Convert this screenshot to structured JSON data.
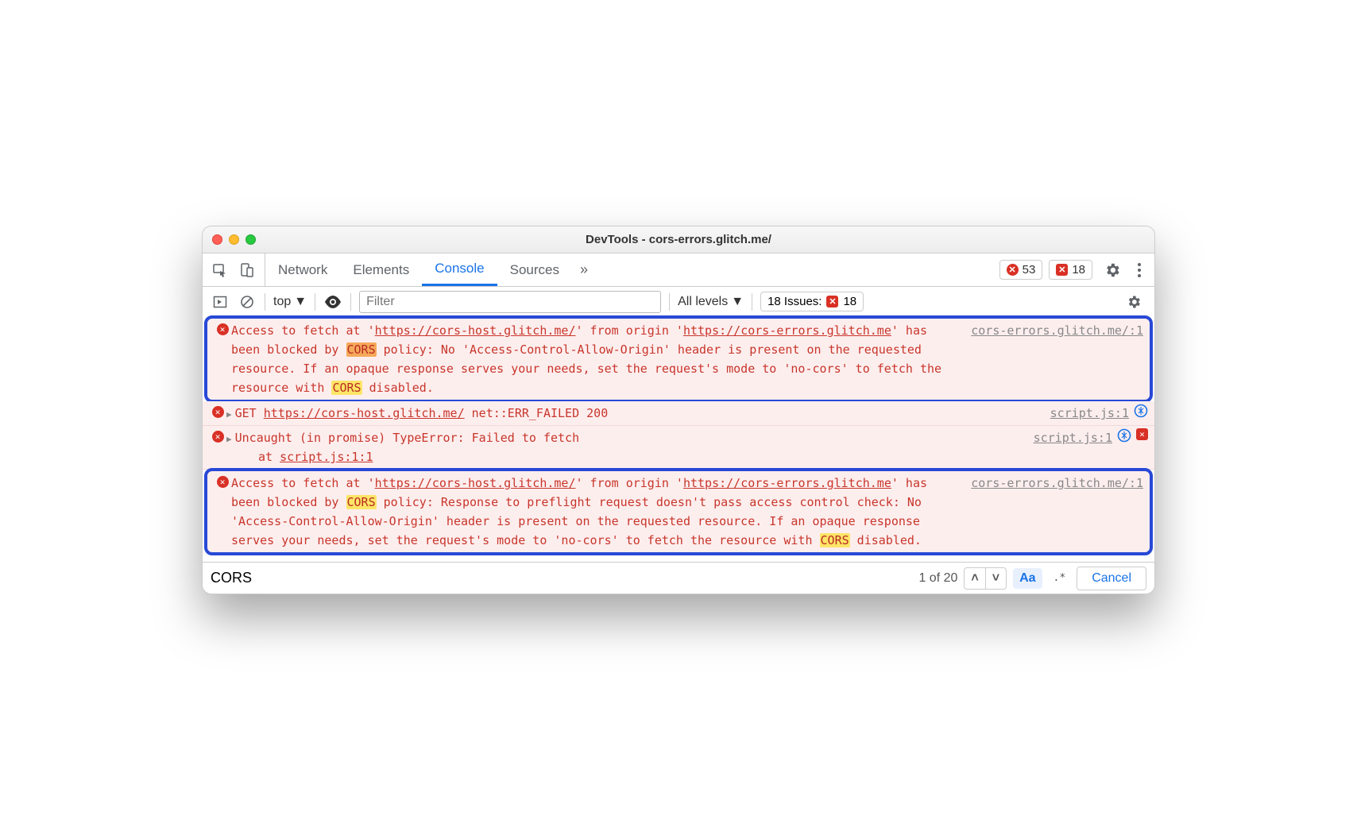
{
  "window": {
    "title_prefix": "DevTools - ",
    "title_url": "cors-errors.glitch.me/"
  },
  "tabs": {
    "items": [
      "Network",
      "Elements",
      "Console",
      "Sources"
    ],
    "active": "Console",
    "more_glyph": "»"
  },
  "counters": {
    "errors": "53",
    "issues": "18"
  },
  "toolbar": {
    "context": "top",
    "filter_placeholder": "Filter",
    "levels": "All levels",
    "issues_label": "18 Issues:",
    "issues_count": "18"
  },
  "messages": [
    {
      "type": "error",
      "highlighted": true,
      "source": "cors-errors.glitch.me/:1",
      "segments": [
        {
          "t": "Access to fetch at '"
        },
        {
          "t": "https://cors-host.glitch.me/",
          "u": true
        },
        {
          "t": "' from origin '"
        },
        {
          "t": "https://cors-errors.glitch.me",
          "u": true
        },
        {
          "t": "' has been blocked by "
        },
        {
          "t": "CORS",
          "hl": "orange"
        },
        {
          "t": " policy: No 'Access-Control-Allow-Origin' header is present on the requested resource. If an opaque response serves your needs, set the request's mode to 'no-cors' to fetch the resource with "
        },
        {
          "t": "CORS",
          "hl": "yellow"
        },
        {
          "t": " disabled."
        }
      ]
    },
    {
      "type": "error",
      "disclose": true,
      "source": "script.js:1",
      "right_icons": [
        "spinner"
      ],
      "segments": [
        {
          "t": "GET "
        },
        {
          "t": "https://cors-host.glitch.me/",
          "u": true
        },
        {
          "t": " net::ERR_FAILED 200"
        }
      ]
    },
    {
      "type": "error",
      "disclose": true,
      "source": "script.js:1",
      "right_icons": [
        "spinner",
        "issue"
      ],
      "segments": [
        {
          "t": "Uncaught (in promise) TypeError: Failed to fetch"
        }
      ],
      "stack": [
        {
          "t": "at "
        },
        {
          "t": "script.js:1:1",
          "u": true
        }
      ]
    },
    {
      "type": "error",
      "highlighted": true,
      "source": "cors-errors.glitch.me/:1",
      "segments": [
        {
          "t": "Access to fetch at '"
        },
        {
          "t": "https://cors-host.glitch.me/",
          "u": true
        },
        {
          "t": "' from origin '"
        },
        {
          "t": "https://cors-errors.glitch.me",
          "u": true
        },
        {
          "t": "' has been blocked by "
        },
        {
          "t": "CORS",
          "hl": "yellow"
        },
        {
          "t": " policy: Response to preflight request doesn't pass access control check: No 'Access-Control-Allow-Origin' header is present on the requested resource. If an opaque response serves your needs, set the request's mode to 'no-cors' to fetch the resource with "
        },
        {
          "t": "CORS",
          "hl": "yellow"
        },
        {
          "t": " disabled."
        }
      ]
    }
  ],
  "search": {
    "query": "CORS",
    "count": "1 of 20",
    "cancel": "Cancel"
  }
}
